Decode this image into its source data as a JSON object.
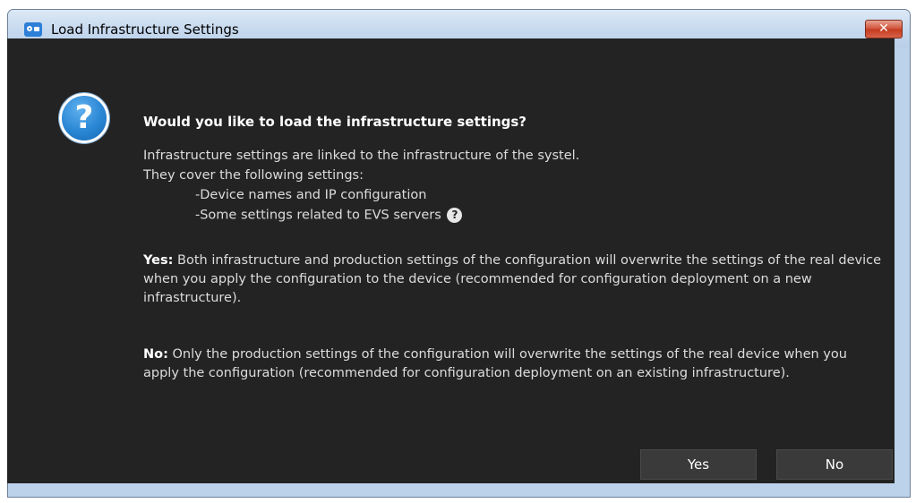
{
  "window": {
    "title": "Load Infrastructure Settings",
    "close_label": "✕"
  },
  "dialog": {
    "heading": "Would you like to load the infrastructure settings?",
    "intro_line1": "Infrastructure settings are linked to the infrastructure of the systel.",
    "intro_line2": "They cover the following settings:",
    "bullet1": "-Device names and IP configuration",
    "bullet2": "-Some settings related to EVS servers",
    "yes_label": "Yes:",
    "yes_text": " Both infrastructure and production settings of the configuration will overwrite the settings of the real device when you apply the configuration to the device (recommended for configuration deployment on a new infrastructure).",
    "no_label": "No:",
    "no_text": " Only the production settings of the configuration will overwrite the settings of the real device when you apply the configuration (recommended for configuration deployment on an existing infrastructure)."
  },
  "buttons": {
    "yes": "Yes",
    "no": "No"
  },
  "icons": {
    "app": "app-icon",
    "question": "question-icon",
    "help": "help-icon",
    "close": "close-icon"
  },
  "colors": {
    "background": "#232323",
    "text": "#dcdcdc",
    "titlebar": "#c5d8ee",
    "close_button": "#c53a1e",
    "question_icon": "#2a86d4"
  }
}
